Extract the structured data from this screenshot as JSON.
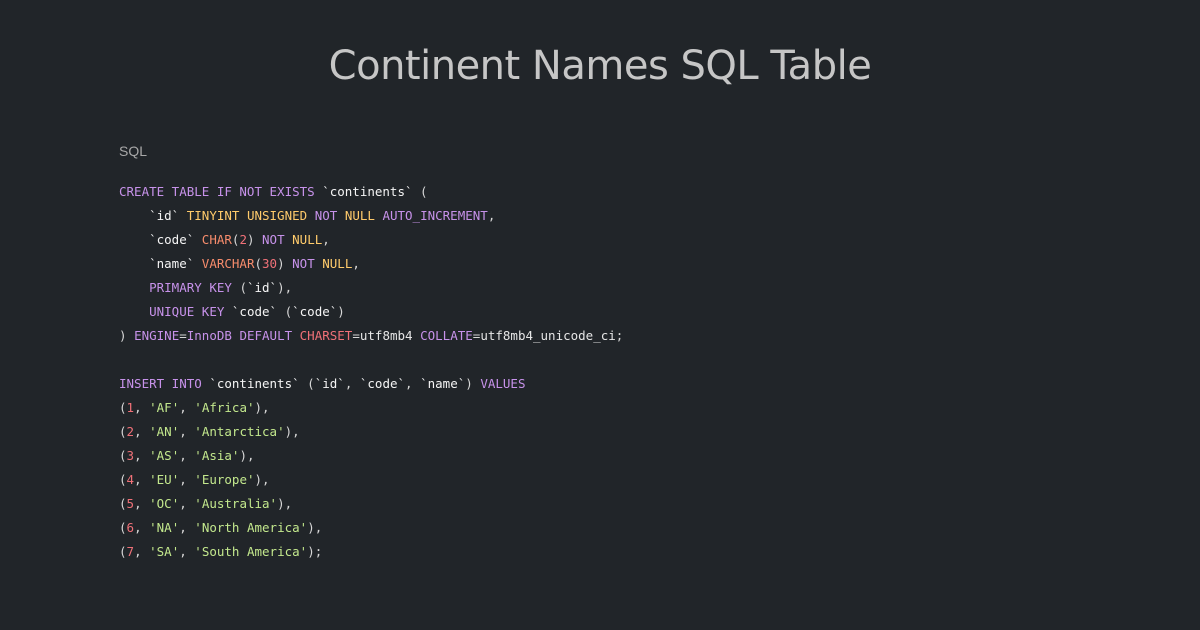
{
  "page": {
    "title": "Continent Names SQL Table",
    "language_label": "SQL"
  },
  "colors": {
    "background": "#212529",
    "keyword": "#c792ea",
    "type": "#ffcb6b",
    "number": "#f07178",
    "string": "#c3e88d",
    "function": "#f78c6c",
    "identifier": "#f5f5f5",
    "punctuation": "#d8d8d8"
  },
  "code": {
    "lines": [
      [
        {
          "t": "kw",
          "v": "CREATE TABLE IF NOT EXISTS"
        },
        {
          "t": "plain",
          "v": " "
        },
        {
          "t": "id",
          "v": "`continents`"
        },
        {
          "t": "plain",
          "v": " "
        },
        {
          "t": "punc",
          "v": "("
        }
      ],
      [
        {
          "t": "plain",
          "v": "    "
        },
        {
          "t": "id",
          "v": "`id`"
        },
        {
          "t": "plain",
          "v": " "
        },
        {
          "t": "type",
          "v": "TINYINT UNSIGNED"
        },
        {
          "t": "plain",
          "v": " "
        },
        {
          "t": "kw",
          "v": "NOT"
        },
        {
          "t": "plain",
          "v": " "
        },
        {
          "t": "type",
          "v": "NULL"
        },
        {
          "t": "plain",
          "v": " "
        },
        {
          "t": "kw",
          "v": "AUTO_INCREMENT"
        },
        {
          "t": "punc",
          "v": ","
        }
      ],
      [
        {
          "t": "plain",
          "v": "    "
        },
        {
          "t": "id",
          "v": "`code`"
        },
        {
          "t": "plain",
          "v": " "
        },
        {
          "t": "fn",
          "v": "CHAR"
        },
        {
          "t": "punc",
          "v": "("
        },
        {
          "t": "num",
          "v": "2"
        },
        {
          "t": "punc",
          "v": ")"
        },
        {
          "t": "plain",
          "v": " "
        },
        {
          "t": "kw",
          "v": "NOT"
        },
        {
          "t": "plain",
          "v": " "
        },
        {
          "t": "type",
          "v": "NULL"
        },
        {
          "t": "punc",
          "v": ","
        }
      ],
      [
        {
          "t": "plain",
          "v": "    "
        },
        {
          "t": "id",
          "v": "`name`"
        },
        {
          "t": "plain",
          "v": " "
        },
        {
          "t": "fn",
          "v": "VARCHAR"
        },
        {
          "t": "punc",
          "v": "("
        },
        {
          "t": "num",
          "v": "30"
        },
        {
          "t": "punc",
          "v": ")"
        },
        {
          "t": "plain",
          "v": " "
        },
        {
          "t": "kw",
          "v": "NOT"
        },
        {
          "t": "plain",
          "v": " "
        },
        {
          "t": "type",
          "v": "NULL"
        },
        {
          "t": "punc",
          "v": ","
        }
      ],
      [
        {
          "t": "plain",
          "v": "    "
        },
        {
          "t": "kw",
          "v": "PRIMARY KEY"
        },
        {
          "t": "plain",
          "v": " "
        },
        {
          "t": "punc",
          "v": "("
        },
        {
          "t": "id",
          "v": "`id`"
        },
        {
          "t": "punc",
          "v": "),"
        }
      ],
      [
        {
          "t": "plain",
          "v": "    "
        },
        {
          "t": "kw",
          "v": "UNIQUE KEY"
        },
        {
          "t": "plain",
          "v": " "
        },
        {
          "t": "id",
          "v": "`code`"
        },
        {
          "t": "plain",
          "v": " "
        },
        {
          "t": "punc",
          "v": "("
        },
        {
          "t": "id",
          "v": "`code`"
        },
        {
          "t": "punc",
          "v": ")"
        }
      ],
      [
        {
          "t": "punc",
          "v": ")"
        },
        {
          "t": "plain",
          "v": " "
        },
        {
          "t": "kw",
          "v": "ENGINE"
        },
        {
          "t": "punc",
          "v": "="
        },
        {
          "t": "kw",
          "v": "InnoDB"
        },
        {
          "t": "plain",
          "v": " "
        },
        {
          "t": "kw",
          "v": "DEFAULT"
        },
        {
          "t": "plain",
          "v": " "
        },
        {
          "t": "num",
          "v": "CHARSET"
        },
        {
          "t": "punc",
          "v": "="
        },
        {
          "t": "plain",
          "v": "utf8mb4"
        },
        {
          "t": "plain",
          "v": " "
        },
        {
          "t": "kw",
          "v": "COLLATE"
        },
        {
          "t": "punc",
          "v": "="
        },
        {
          "t": "plain",
          "v": "utf8mb4_unicode_ci"
        },
        {
          "t": "punc",
          "v": ";"
        }
      ],
      [],
      [
        {
          "t": "kw",
          "v": "INSERT INTO"
        },
        {
          "t": "plain",
          "v": " "
        },
        {
          "t": "id",
          "v": "`continents`"
        },
        {
          "t": "plain",
          "v": " "
        },
        {
          "t": "punc",
          "v": "("
        },
        {
          "t": "id",
          "v": "`id`"
        },
        {
          "t": "punc",
          "v": ", "
        },
        {
          "t": "id",
          "v": "`code`"
        },
        {
          "t": "punc",
          "v": ", "
        },
        {
          "t": "id",
          "v": "`name`"
        },
        {
          "t": "punc",
          "v": ")"
        },
        {
          "t": "plain",
          "v": " "
        },
        {
          "t": "kw",
          "v": "VALUES"
        }
      ],
      [
        {
          "t": "punc",
          "v": "("
        },
        {
          "t": "num",
          "v": "1"
        },
        {
          "t": "punc",
          "v": ", "
        },
        {
          "t": "str",
          "v": "'AF'"
        },
        {
          "t": "punc",
          "v": ", "
        },
        {
          "t": "str",
          "v": "'Africa'"
        },
        {
          "t": "punc",
          "v": "),"
        }
      ],
      [
        {
          "t": "punc",
          "v": "("
        },
        {
          "t": "num",
          "v": "2"
        },
        {
          "t": "punc",
          "v": ", "
        },
        {
          "t": "str",
          "v": "'AN'"
        },
        {
          "t": "punc",
          "v": ", "
        },
        {
          "t": "str",
          "v": "'Antarctica'"
        },
        {
          "t": "punc",
          "v": "),"
        }
      ],
      [
        {
          "t": "punc",
          "v": "("
        },
        {
          "t": "num",
          "v": "3"
        },
        {
          "t": "punc",
          "v": ", "
        },
        {
          "t": "str",
          "v": "'AS'"
        },
        {
          "t": "punc",
          "v": ", "
        },
        {
          "t": "str",
          "v": "'Asia'"
        },
        {
          "t": "punc",
          "v": "),"
        }
      ],
      [
        {
          "t": "punc",
          "v": "("
        },
        {
          "t": "num",
          "v": "4"
        },
        {
          "t": "punc",
          "v": ", "
        },
        {
          "t": "str",
          "v": "'EU'"
        },
        {
          "t": "punc",
          "v": ", "
        },
        {
          "t": "str",
          "v": "'Europe'"
        },
        {
          "t": "punc",
          "v": "),"
        }
      ],
      [
        {
          "t": "punc",
          "v": "("
        },
        {
          "t": "num",
          "v": "5"
        },
        {
          "t": "punc",
          "v": ", "
        },
        {
          "t": "str",
          "v": "'OC'"
        },
        {
          "t": "punc",
          "v": ", "
        },
        {
          "t": "str",
          "v": "'Australia'"
        },
        {
          "t": "punc",
          "v": "),"
        }
      ],
      [
        {
          "t": "punc",
          "v": "("
        },
        {
          "t": "num",
          "v": "6"
        },
        {
          "t": "punc",
          "v": ", "
        },
        {
          "t": "str",
          "v": "'NA'"
        },
        {
          "t": "punc",
          "v": ", "
        },
        {
          "t": "str",
          "v": "'North America'"
        },
        {
          "t": "punc",
          "v": "),"
        }
      ],
      [
        {
          "t": "punc",
          "v": "("
        },
        {
          "t": "num",
          "v": "7"
        },
        {
          "t": "punc",
          "v": ", "
        },
        {
          "t": "str",
          "v": "'SA'"
        },
        {
          "t": "punc",
          "v": ", "
        },
        {
          "t": "str",
          "v": "'South America'"
        },
        {
          "t": "punc",
          "v": ");"
        }
      ]
    ]
  }
}
